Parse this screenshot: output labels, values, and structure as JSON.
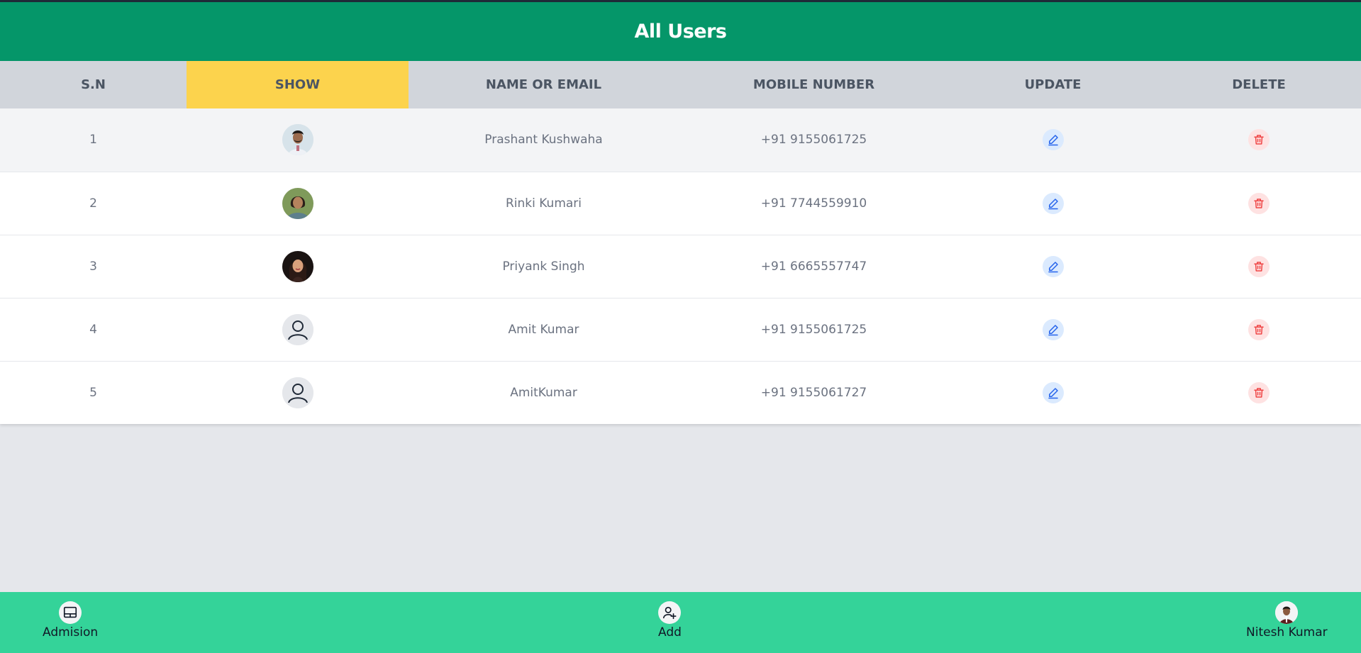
{
  "header": {
    "title": "All Users"
  },
  "table": {
    "columns": [
      "S.N",
      "SHOW",
      "NAME OR EMAIL",
      "MOBILE NUMBER",
      "UPDATE",
      "DELETE"
    ],
    "rows": [
      {
        "sn": "1",
        "name": "Prashant Kushwaha",
        "mobile": "+91 9155061725",
        "avatar": "photo-man-light"
      },
      {
        "sn": "2",
        "name": "Rinki Kumari",
        "mobile": "+91 7744559910",
        "avatar": "photo-woman-outdoor"
      },
      {
        "sn": "3",
        "name": "Priyank Singh",
        "mobile": "+91 6665557747",
        "avatar": "photo-woman-dark"
      },
      {
        "sn": "4",
        "name": "Amit Kumar",
        "mobile": "+91 9155061725",
        "avatar": "default-user-icon"
      },
      {
        "sn": "5",
        "name": "AmitKumar",
        "mobile": "+91 9155061727",
        "avatar": "default-user-icon"
      }
    ]
  },
  "footer": {
    "admission_label": "Admision",
    "add_label": "Add",
    "profile_label": "Nitesh Kumar"
  },
  "colors": {
    "header_bg": "#059669",
    "footer_bg": "#34d399",
    "highlight_column": "#fcd34d",
    "edit_icon": "#2563eb",
    "delete_icon": "#ef4444"
  }
}
